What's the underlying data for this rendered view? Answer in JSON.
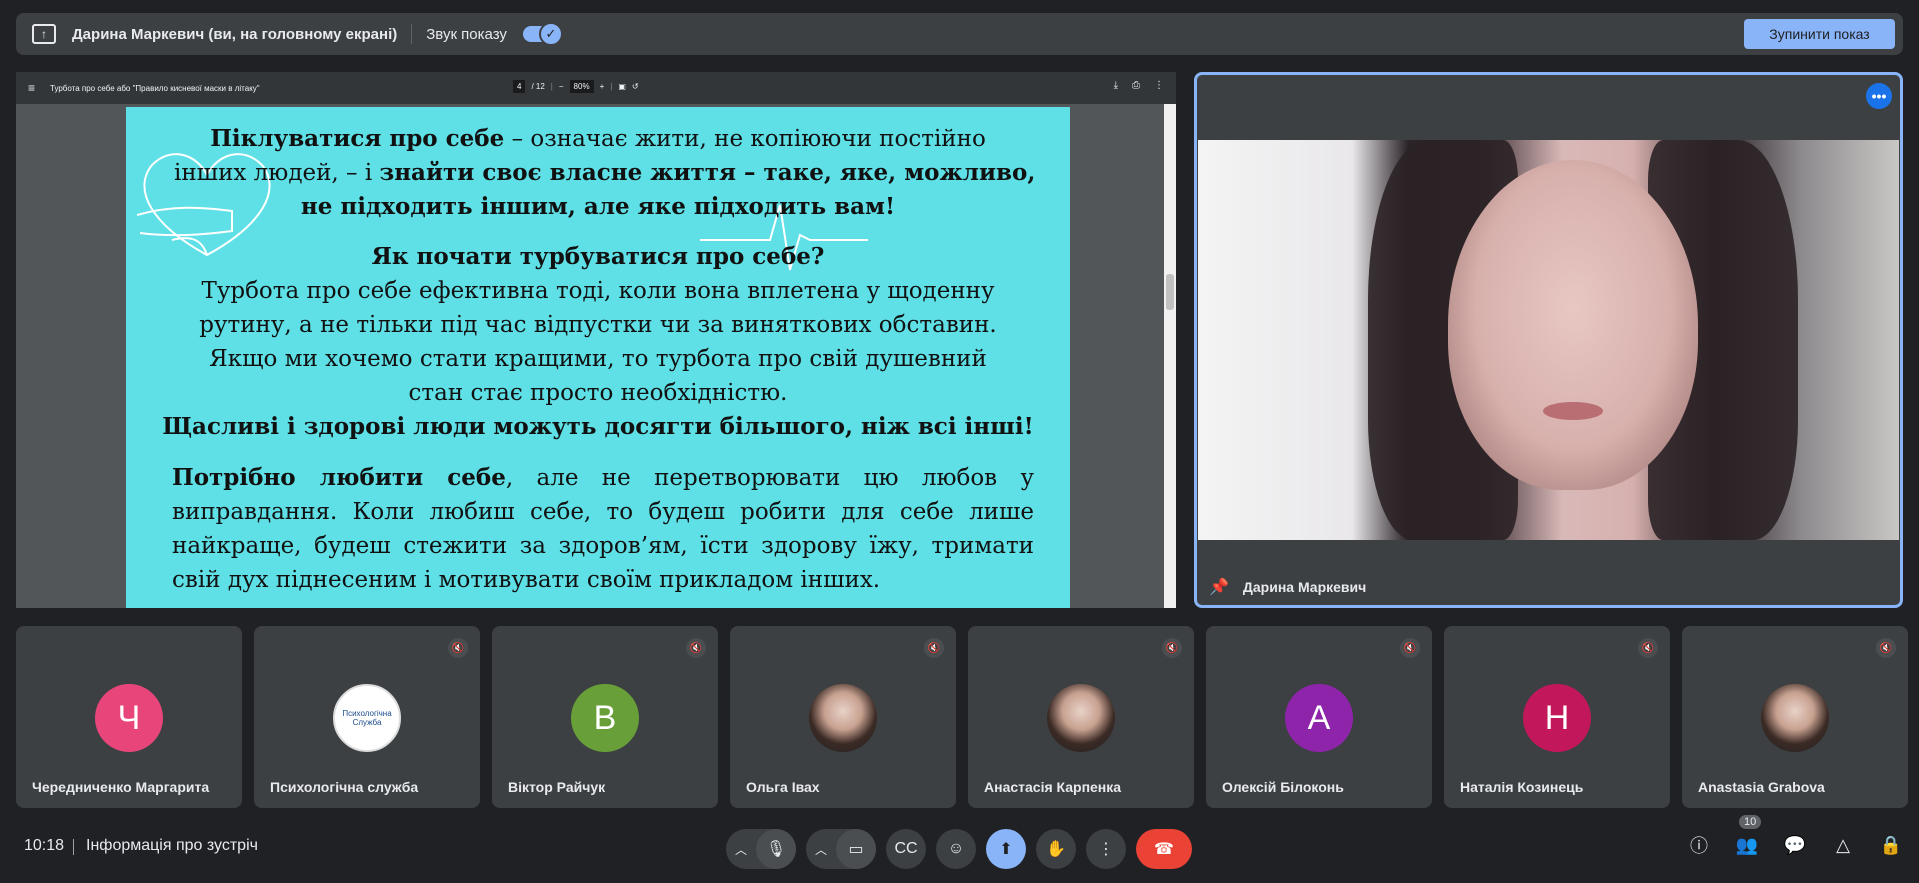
{
  "top_bar": {
    "presenter_text": "Дарина Маркевич (ви, на головному екрані)",
    "sound_label": "Звук показу",
    "stop_button": "Зупинити показ"
  },
  "pdf": {
    "title": "Турбота про себе або \"Правило кисневої маски в літаку\"",
    "page_current": "4",
    "page_total": "/ 12",
    "zoom": "80%",
    "lines": {
      "p1a_bold": "Піклуватися про себе",
      "p1a_rest": " – означає жити, не копіюючи постійно",
      "p1b_plain": "інших людей, – і ",
      "p1b_bold": "знайти своє власне життя – таке, яке, можливо,",
      "p1c": "не підходить іншим, але яке підходить вам!",
      "h2": "Як почати турбуватися про себе?",
      "p2a": "Турбота про себе ефективна тоді, коли вона вплетена у щоденну",
      "p2b": "рутину, а не тільки під час відпустки чи за виняткових обставин.",
      "p2c": "Якщо ми хочемо стати кращими, то турбота про свій душевний",
      "p2d": "стан стає просто необхідністю.",
      "p3": "Щасливі і здорові люди можуть досягти більшого, ніж всі інші!",
      "p4a_bold": "Потрібно любити себе",
      "p4a_rest": ", але не перетворювати цю любов у",
      "p4b": "виправдання. Коли любиш себе, то будеш робити для себе лише",
      "p4c": "найкраще, будеш стежити за здоров’ям, їсти здорову їжу, тримати",
      "p4d": "свій дух піднесеним і мотивувати своїм прикладом інших."
    }
  },
  "speaker": {
    "name": "Дарина Маркевич"
  },
  "participants": [
    {
      "name": "Чередниченко Маргарита",
      "initial": "Ч",
      "color": "#e8457a",
      "muted": false
    },
    {
      "name": "Психологічна служба",
      "initial": "",
      "logo_text": "Психологічна Служба",
      "color": "#ffffff",
      "muted": true
    },
    {
      "name": "Віктор Райчук",
      "initial": "В",
      "color": "#689f38",
      "muted": true
    },
    {
      "name": "Ольга Івах",
      "initial": "",
      "color": "#8d6e63",
      "muted": true
    },
    {
      "name": "Анастасія Карпенка",
      "initial": "",
      "color": "#5d4037",
      "muted": true
    },
    {
      "name": "Олексій Білоконь",
      "initial": "А",
      "color": "#8e24aa",
      "muted": true
    },
    {
      "name": "Наталія Козинець",
      "initial": "Н",
      "color": "#c2185b",
      "muted": true
    },
    {
      "name": "Anastasia Grabova",
      "initial": "",
      "color": "#a1887f",
      "muted": true
    }
  ],
  "bottom_bar": {
    "time": "10:18",
    "meeting_info": "Інформація про зустріч",
    "people_count": "10"
  },
  "colors": {
    "accent": "#8ab4f8",
    "leave": "#ea4335",
    "slide_bg": "#5ee0e6"
  }
}
